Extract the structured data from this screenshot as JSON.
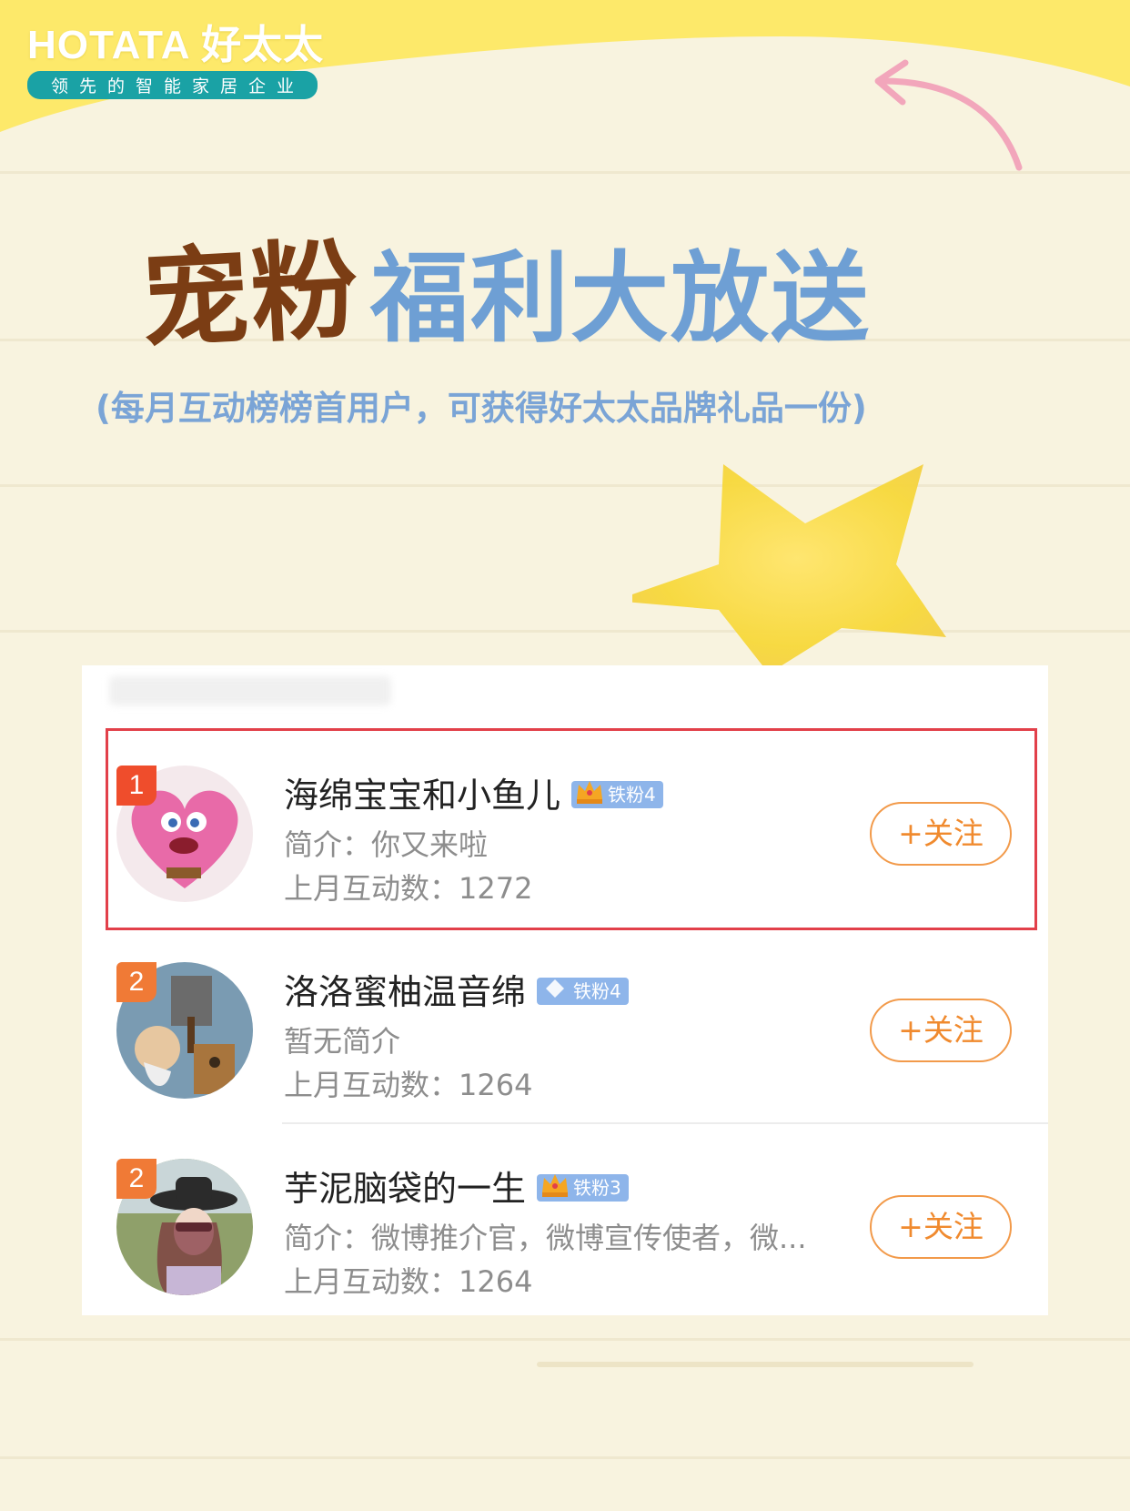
{
  "brand": {
    "name": "HOTATA 好太太",
    "slogan": "领先的智能家居企业"
  },
  "headline": {
    "part1": "宠粉",
    "part2": "福利大放送",
    "subtitle": "(每月互动榜榜首用户，可获得好太太品牌礼品一份)"
  },
  "colors": {
    "accent_yellow": "#fde96a",
    "title_brown": "#7b3d14",
    "title_blue": "#6e9fd4",
    "highlight_red": "#e2404a",
    "follow_orange": "#f08a2e"
  },
  "ranking": {
    "rows": [
      {
        "rank": "1",
        "name": "海绵宝宝和小鱼儿",
        "badge": "铁粉4",
        "badge_icon": "crown-icon",
        "intro": "简介：你又来啦",
        "count": "上月互动数：1272",
        "follow": "+关注"
      },
      {
        "rank": "2",
        "name": "洛洛蜜柚温音绵",
        "badge": "铁粉4",
        "badge_icon": "diamond-icon",
        "intro": "暂无简介",
        "count": "上月互动数：1264",
        "follow": "+关注"
      },
      {
        "rank": "2",
        "name": "芋泥脑袋的一生",
        "badge": "铁粉3",
        "badge_icon": "crown-icon",
        "intro": "简介：微博推介官，微博宣传使者，微...",
        "count": "上月互动数：1264",
        "follow": "+关注"
      }
    ]
  }
}
